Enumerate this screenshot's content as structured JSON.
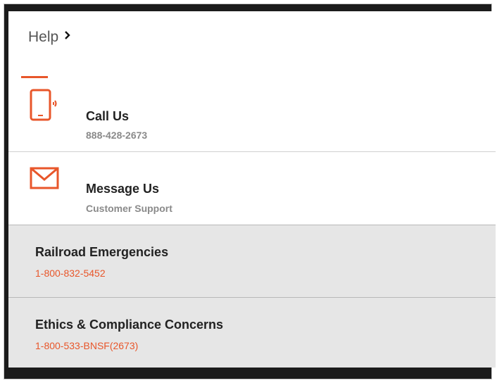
{
  "header": {
    "title": "Help",
    "chevron_icon": "chevron-right-icon"
  },
  "colors": {
    "accent": "#e8562a",
    "grey_row": "#e6e6e6",
    "frame": "#1b1b1b"
  },
  "contacts": [
    {
      "title": "Call Us",
      "subtitle": "888-428-2673",
      "icon": "phone-icon"
    },
    {
      "title": "Message Us",
      "subtitle": "Customer Support",
      "icon": "envelope-icon"
    }
  ],
  "special_lines": [
    {
      "title": "Railroad Emergencies",
      "phone": "1-800-832-5452"
    },
    {
      "title": "Ethics & Compliance Concerns",
      "phone": "1-800-533-BNSF(2673)"
    }
  ]
}
